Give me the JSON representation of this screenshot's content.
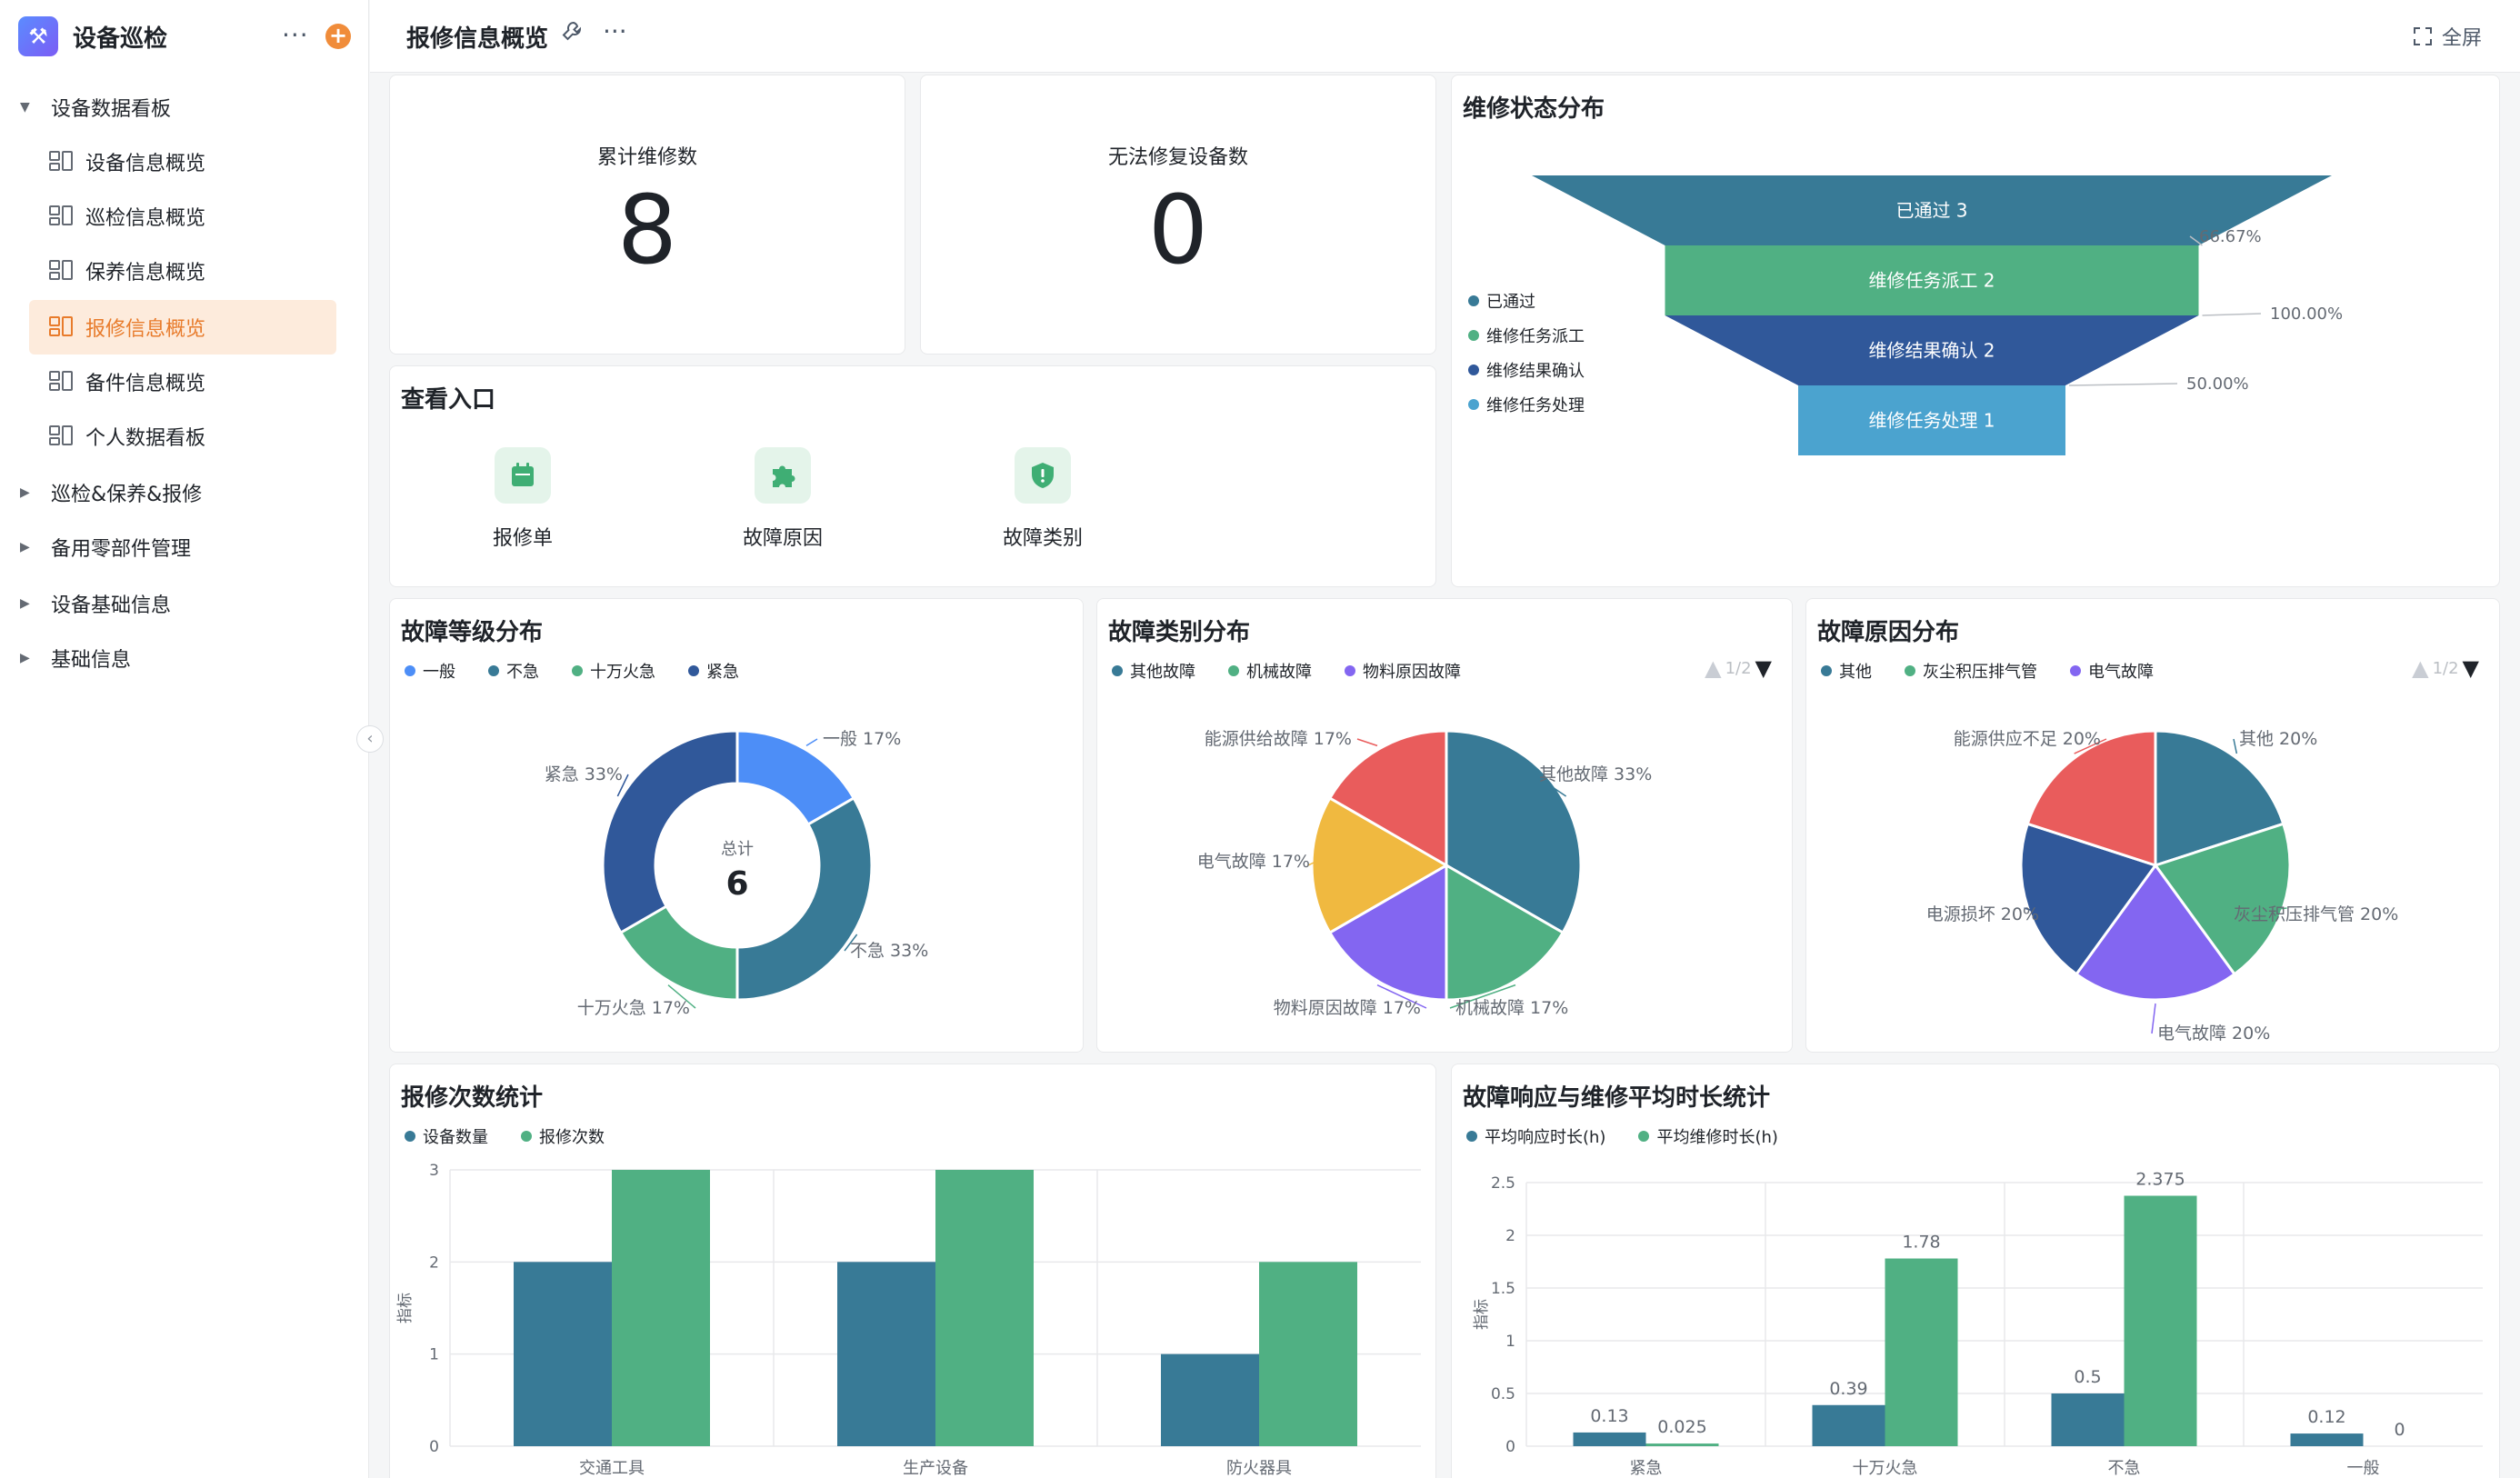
{
  "app": {
    "title": "设备巡检"
  },
  "nav": {
    "groups": [
      {
        "label": "设备数据看板",
        "caret": "▼"
      },
      {
        "label": "巡检&保养&报修",
        "caret": "▶"
      },
      {
        "label": "备用零部件管理",
        "caret": "▶"
      },
      {
        "label": "设备基础信息",
        "caret": "▶"
      },
      {
        "label": "基础信息",
        "caret": "▶"
      }
    ],
    "pages": [
      {
        "label": "设备信息概览"
      },
      {
        "label": "巡检信息概览"
      },
      {
        "label": "保养信息概览"
      },
      {
        "label": "报修信息概览",
        "active": true
      },
      {
        "label": "备件信息概览"
      },
      {
        "label": "个人数据看板"
      }
    ]
  },
  "topbar": {
    "title": "报修信息概览",
    "fullscreen": "全屏"
  },
  "kpis": [
    {
      "label": "累计维修数",
      "value": "8"
    },
    {
      "label": "无法修复设备数",
      "value": "0"
    }
  ],
  "entries": {
    "title": "查看入口",
    "items": [
      {
        "label": "报修单",
        "icon": "calendar-icon"
      },
      {
        "label": "故障原因",
        "icon": "puzzle-icon"
      },
      {
        "label": "故障类别",
        "icon": "shield-alert-icon"
      }
    ]
  },
  "colors": {
    "teal": "#387a96",
    "green": "#50b083",
    "navy": "#30589a",
    "lightblue": "#4ba3cf",
    "blue": "#4d8ef7",
    "purple": "#8366f1",
    "yellow": "#f0b940",
    "red": "#e95c5c",
    "orange": "#e87b2b"
  },
  "funnel": {
    "title": "维修状态分布",
    "stages": [
      {
        "label": "已通过 3",
        "name": "已通过",
        "value": 3,
        "color": "#387a96"
      },
      {
        "label": "维修任务派工 2",
        "name": "维修任务派工",
        "value": 2,
        "color": "#50b083"
      },
      {
        "label": "维修结果确认 2",
        "name": "维修结果确认",
        "value": 2,
        "color": "#30589a"
      },
      {
        "label": "维修任务处理 1",
        "name": "维修任务处理",
        "value": 1,
        "color": "#4ba3cf"
      }
    ],
    "conversions": [
      "66.67%",
      "100.00%",
      "50.00%"
    ]
  },
  "chart_data": [
    {
      "type": "pie",
      "title": "故障等级分布",
      "donut": true,
      "center_label": "总计",
      "center_value": "6",
      "slices": [
        {
          "name": "一般",
          "value": 1,
          "label": "一般 17%",
          "color": "#4d8ef7"
        },
        {
          "name": "不急",
          "value": 2,
          "label": "不急 33%",
          "color": "#387a96"
        },
        {
          "name": "十万火急",
          "value": 1,
          "label": "十万火急 17%",
          "color": "#50b083"
        },
        {
          "name": "紧急",
          "value": 2,
          "label": "紧急 33%",
          "color": "#30589a"
        }
      ]
    },
    {
      "type": "pie",
      "title": "故障类别分布",
      "pager": "1/2",
      "legend": [
        {
          "name": "其他故障",
          "color": "#387a96"
        },
        {
          "name": "机械故障",
          "color": "#50b083"
        },
        {
          "name": "物料原因故障",
          "color": "#8366f1"
        }
      ],
      "slices": [
        {
          "name": "其他故障",
          "value": 2,
          "label": "其他故障 33%",
          "color": "#387a96"
        },
        {
          "name": "机械故障",
          "value": 1,
          "label": "机械故障 17%",
          "color": "#50b083"
        },
        {
          "name": "物料原因故障",
          "value": 1,
          "label": "物料原因故障 17%",
          "color": "#8366f1"
        },
        {
          "name": "电气故障",
          "value": 1,
          "label": "电气故障 17%",
          "color": "#f0b940"
        },
        {
          "name": "能源供给故障",
          "value": 1,
          "label": "能源供给故障 17%",
          "color": "#e95c5c"
        }
      ]
    },
    {
      "type": "pie",
      "title": "故障原因分布",
      "pager": "1/2",
      "legend": [
        {
          "name": "其他",
          "color": "#387a96"
        },
        {
          "name": "灰尘积压排气管",
          "color": "#50b083"
        },
        {
          "name": "电气故障",
          "color": "#8366f1"
        }
      ],
      "slices": [
        {
          "name": "其他",
          "value": 1,
          "label": "其他 20%",
          "color": "#387a96"
        },
        {
          "name": "灰尘积压排气管",
          "value": 1,
          "label": "灰尘积压排气管 20%",
          "color": "#50b083"
        },
        {
          "name": "电气故障",
          "value": 1,
          "label": "电气故障 20%",
          "color": "#8366f1"
        },
        {
          "name": "电源损坏",
          "value": 1,
          "label": "电源损坏 20%",
          "color": "#30589a"
        },
        {
          "name": "能源供应不足",
          "value": 1,
          "label": "能源供应不足 20%",
          "color": "#e95c5c"
        }
      ]
    },
    {
      "type": "bar",
      "title": "报修次数统计",
      "ylabel": "指标",
      "ylim": [
        0,
        3
      ],
      "yticks": [
        0,
        1,
        2,
        3
      ],
      "categories": [
        "交通工具",
        "生产设备",
        "防火器具"
      ],
      "series": [
        {
          "name": "设备数量",
          "values": [
            2,
            2,
            1
          ],
          "color": "#387a96"
        },
        {
          "name": "报修次数",
          "values": [
            3,
            3,
            2
          ],
          "color": "#50b083"
        }
      ]
    },
    {
      "type": "bar",
      "title": "故障响应与维修平均时长统计",
      "ylabel": "指标",
      "ylim": [
        0,
        2.5
      ],
      "yticks": [
        0,
        0.5,
        1,
        1.5,
        2,
        2.5
      ],
      "categories": [
        "紧急",
        "十万火急",
        "不急",
        "一般"
      ],
      "series": [
        {
          "name": "平均响应时长(h)",
          "values": [
            0.13,
            0.39,
            0.5,
            0.12
          ],
          "labels": [
            "0.13",
            "0.39",
            "0.5",
            "0.12"
          ],
          "color": "#387a96"
        },
        {
          "name": "平均维修时长(h)",
          "values": [
            0.025,
            1.78,
            2.375,
            0
          ],
          "labels": [
            "0.025",
            "1.78",
            "2.375",
            "0"
          ],
          "color": "#50b083"
        }
      ]
    }
  ]
}
